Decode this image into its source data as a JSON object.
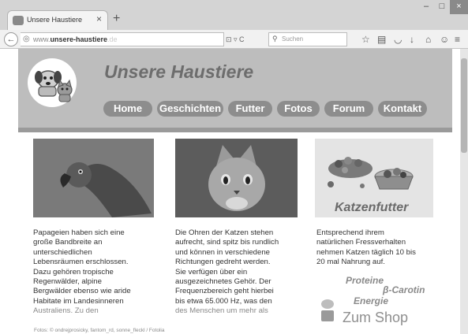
{
  "browser": {
    "tab_title": "Unsere Haustiere",
    "tab_close": "×",
    "new_tab": "+",
    "window_buttons": [
      "–",
      "□",
      "×"
    ],
    "back": "←",
    "url_prefix": "www.",
    "url_domain": "unsere-haustiere",
    "url_suffix": ".de",
    "url_icons": "⊡ ▿ C",
    "search_placeholder": "Suchen",
    "toolbar_icons": [
      "☆",
      "▤",
      "◡",
      "↓",
      "⌂",
      "☺",
      "≡"
    ]
  },
  "site": {
    "title": "Unsere Haustiere",
    "nav": [
      "Home",
      "Geschichten",
      "Futter",
      "Fotos",
      "Forum",
      "Kontakt"
    ]
  },
  "columns": [
    {
      "image": "parrot",
      "lines": [
        "Papageien haben sich eine",
        "große Bandbreite an",
        "unterschiedlichen",
        "Lebensräumen erschlossen.",
        "Dazu gehören tropische",
        "Regenwälder, alpine",
        "Bergwälder ebenso wie aride",
        "Habitate im Landesinneren",
        "Australiens. Zu den"
      ]
    },
    {
      "image": "cat",
      "lines": [
        "Die Ohren der Katzen stehen",
        "aufrecht, sind spitz bis rundlich",
        "und können in verschiedene",
        "Richtungen gedreht werden.",
        "Sie verfügen über ein",
        "ausgezeichnetes Gehör. Der",
        "Frequenzbereich geht hierbei",
        "bis etwa 65.000 Hz, was den",
        "des Menschen um mehr als"
      ]
    },
    {
      "image": "cat-food",
      "image_label": "Katzenfutter",
      "lines": [
        "Entsprechend ihrem",
        "natürlichen Fressverhalten",
        "nehmen Katzen täglich 10 bis",
        "20 mal Nahrung auf."
      ],
      "taglines": [
        "Proteine",
        "β-Carotin",
        "Energie"
      ],
      "shop_label": "Zum Shop"
    }
  ],
  "footer_credit": "Fotos: © ondrejprosicky, fantom_rd, sonne_fleckl / Fotolia"
}
